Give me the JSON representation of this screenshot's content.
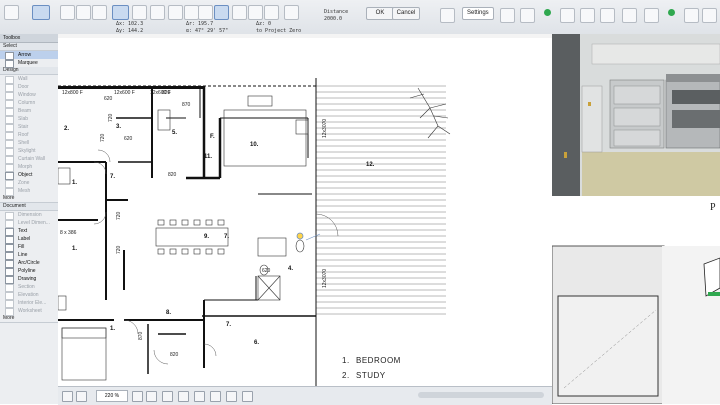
{
  "toolbar": {
    "coords_left": [
      "Δx: 102.3",
      "Δy: 144.2"
    ],
    "coords_mid": [
      "Δr: 195.7",
      "α: 47° 29' 57\""
    ],
    "coords_right": [
      "Δz: 0",
      "to Project Zero"
    ],
    "distance_label": "Distance",
    "distance_value": "2000.0",
    "ok_label": "OK",
    "cancel_label": "Cancel",
    "settings_label": "Settings"
  },
  "toolbox": {
    "title": "Toolbox",
    "select_label": "Select",
    "tools_select": [
      {
        "label": "Arrow",
        "state": "sel"
      },
      {
        "label": "Marquee",
        "state": "on"
      }
    ],
    "design_label": "Design",
    "tools_design": [
      {
        "label": "Wall",
        "state": "dim"
      },
      {
        "label": "Door",
        "state": "dim"
      },
      {
        "label": "Window",
        "state": "dim"
      },
      {
        "label": "Column",
        "state": "dim"
      },
      {
        "label": "Beam",
        "state": "dim"
      },
      {
        "label": "Slab",
        "state": "dim"
      },
      {
        "label": "Stair",
        "state": "dim"
      },
      {
        "label": "Roof",
        "state": "dim"
      },
      {
        "label": "Shell",
        "state": "dim"
      },
      {
        "label": "Skylight",
        "state": "dim"
      },
      {
        "label": "Curtain Wall",
        "state": "dim"
      },
      {
        "label": "Morph",
        "state": "dim"
      },
      {
        "label": "Object",
        "state": "on"
      },
      {
        "label": "Zone",
        "state": "dim"
      },
      {
        "label": "Mesh",
        "state": "dim"
      }
    ],
    "more_label_1": "More",
    "document_label": "Document",
    "tools_document": [
      {
        "label": "Dimension",
        "state": "dim"
      },
      {
        "label": "Level Dimen...",
        "state": "dim"
      },
      {
        "label": "Text",
        "state": "on"
      },
      {
        "label": "Label",
        "state": "on"
      },
      {
        "label": "Fill",
        "state": "on"
      },
      {
        "label": "Line",
        "state": "on"
      },
      {
        "label": "Arc/Circle",
        "state": "on"
      },
      {
        "label": "Polyline",
        "state": "on"
      },
      {
        "label": "Drawing",
        "state": "on"
      },
      {
        "label": "Section",
        "state": "dim"
      },
      {
        "label": "Elevation",
        "state": "dim"
      },
      {
        "label": "Interior Ele...",
        "state": "dim"
      },
      {
        "label": "Worksheet",
        "state": "dim"
      }
    ],
    "more_label_2": "More"
  },
  "plan": {
    "dims": [
      "12x800 F",
      "12x600 F",
      "12x600 F",
      "870",
      "720",
      "620",
      "820",
      "720",
      "720",
      "620",
      "870",
      "820",
      "720",
      "620",
      "820",
      "12x3070",
      "12x3070",
      "8 x 386"
    ],
    "rooms": [
      "2.",
      "3.",
      "5.",
      "F.",
      "10.",
      "11.",
      "12.",
      "7.",
      "7.",
      "1.",
      "9.",
      "4.",
      "1.",
      "8.",
      "7.",
      "6.",
      "1."
    ],
    "legend": [
      {
        "num": "1.",
        "name": "BEDROOM"
      },
      {
        "num": "2.",
        "name": "STUDY"
      }
    ]
  },
  "status": {
    "zoom": "220 %"
  },
  "render": {
    "partial_text": "P"
  },
  "colors": {
    "accent": "#6b8fc2",
    "green": "#2fa84f"
  }
}
